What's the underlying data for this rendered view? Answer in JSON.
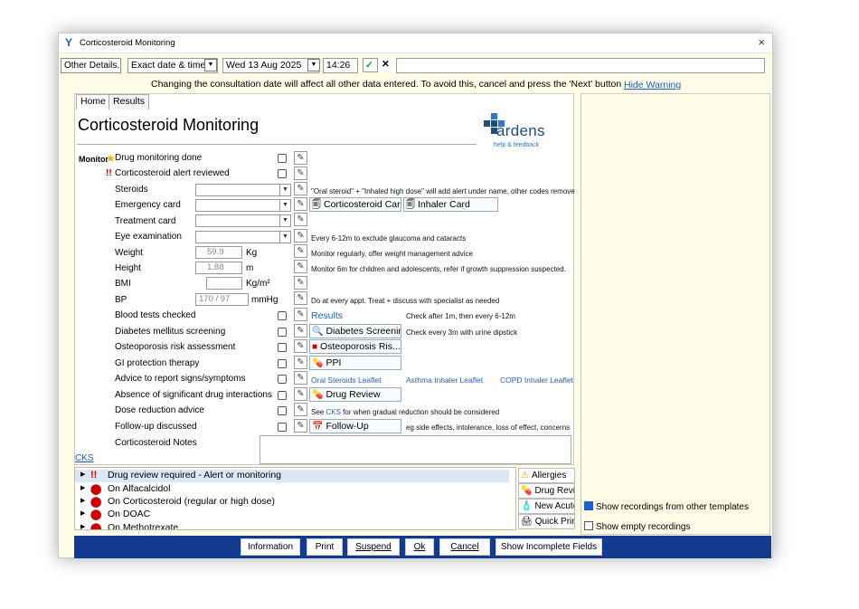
{
  "window": {
    "title": "Corticosteroid Monitoring",
    "close": "×"
  },
  "toolbar": {
    "other_details": "Other Details...",
    "date_mode": "Exact date & time",
    "date": "Wed 13 Aug 2025",
    "time": "14:26",
    "confirm": "✓",
    "cancel": "✕",
    "free_text": ""
  },
  "warning": {
    "text": "Changing the consultation date will affect all other data entered. To avoid this, cancel and press the 'Next' button",
    "link": "Hide Warning"
  },
  "tabs": [
    {
      "label": "Home"
    },
    {
      "label": "Results"
    }
  ],
  "form": {
    "title": "Corticosteroid Monitoring",
    "logo": {
      "name": "ardens",
      "sub": "help & feedback"
    },
    "monitor_label": "Monitor",
    "rows": {
      "drug_monitoring": "Drug monitoring done",
      "alert_reviewed": "Corticosteroid alert reviewed",
      "steroids": "Steroids",
      "emergency_card": "Emergency card",
      "treatment_card": "Treatment card",
      "eye_exam": "Eye examination",
      "weight": "Weight",
      "height": "Height",
      "bmi": "BMI",
      "bp": "BP",
      "blood_tests": "Blood tests checked",
      "diabetes": "Diabetes mellitus screening",
      "osteoporosis": "Osteoporosis risk assessment",
      "gi": "GI protection therapy",
      "advice": "Advice to report signs/symptoms",
      "interactions": "Absence of significant drug interactions",
      "dose_reduction": "Dose reduction advice",
      "follow_up": "Follow-up discussed",
      "notes": "Corticosteroid Notes"
    },
    "values": {
      "weight": "59.9",
      "weight_unit": "Kg",
      "height": "1.88",
      "height_unit": "m",
      "bmi": "",
      "bmi_unit": "Kg/m²",
      "bp": "170 / 97",
      "bp_unit": "mmHg"
    },
    "notes_text": {
      "steroids": "\"Oral steroid\" + \"Inhaled high dose\" will add alert under name, other codes remove",
      "eye": "Every 6-12m to exclude glaucoma and cataracts",
      "weight": "Monitor regularly, offer weight management advice",
      "height": "Monitor 6m for children and adolescents, refer if growth suppression suspected.",
      "bp": "Do at every appt. Treat + discuss with specialist as needed",
      "blood": "Check after 1m, then every 6-12m",
      "diabetes": "Check every 3m with urine dipstick",
      "dose_pre": "See",
      "dose_link": "CKS",
      "dose_post": "for when gradual reduction should be considered",
      "follow": "eg side effects, intolerance, loss of effect, concerns"
    },
    "buttons": {
      "cort_card": "Corticosteroid Card",
      "inhaler_card": "Inhaler Card",
      "results": "Results",
      "diabetes_screening": "Diabetes Screening",
      "osteoporosis": "Osteoporosis Ris...",
      "ppi": "PPI",
      "drug_review": "Drug Review",
      "follow_up": "Follow-Up"
    },
    "leaflets": [
      "Oral Steroids Leaflet",
      "Asthma Inhaler Leaflet",
      "COPD Inhaler Leaflet"
    ],
    "cks": "CKS"
  },
  "alerts": [
    {
      "icon": "!!",
      "text": "Drug review required - Alert or monitoring"
    },
    {
      "icon": "!",
      "text": "On Alfacalcidol"
    },
    {
      "icon": "!",
      "text": "On Corticosteroid (regular or high dose)"
    },
    {
      "icon": "!",
      "text": "On DOAC"
    },
    {
      "icon": "!",
      "text": "On Methotrexate"
    }
  ],
  "side_buttons": [
    "Allergies",
    "Drug Revie",
    "New Acute",
    "Quick Prin"
  ],
  "right_panel": {
    "show_other": "Show recordings from other templates",
    "show_empty": "Show empty recordings",
    "show_other_checked": true,
    "show_empty_checked": false
  },
  "bottom_buttons": [
    "Information",
    "Print",
    "Suspend",
    "Ok",
    "Cancel",
    "Show Incomplete Fields"
  ]
}
